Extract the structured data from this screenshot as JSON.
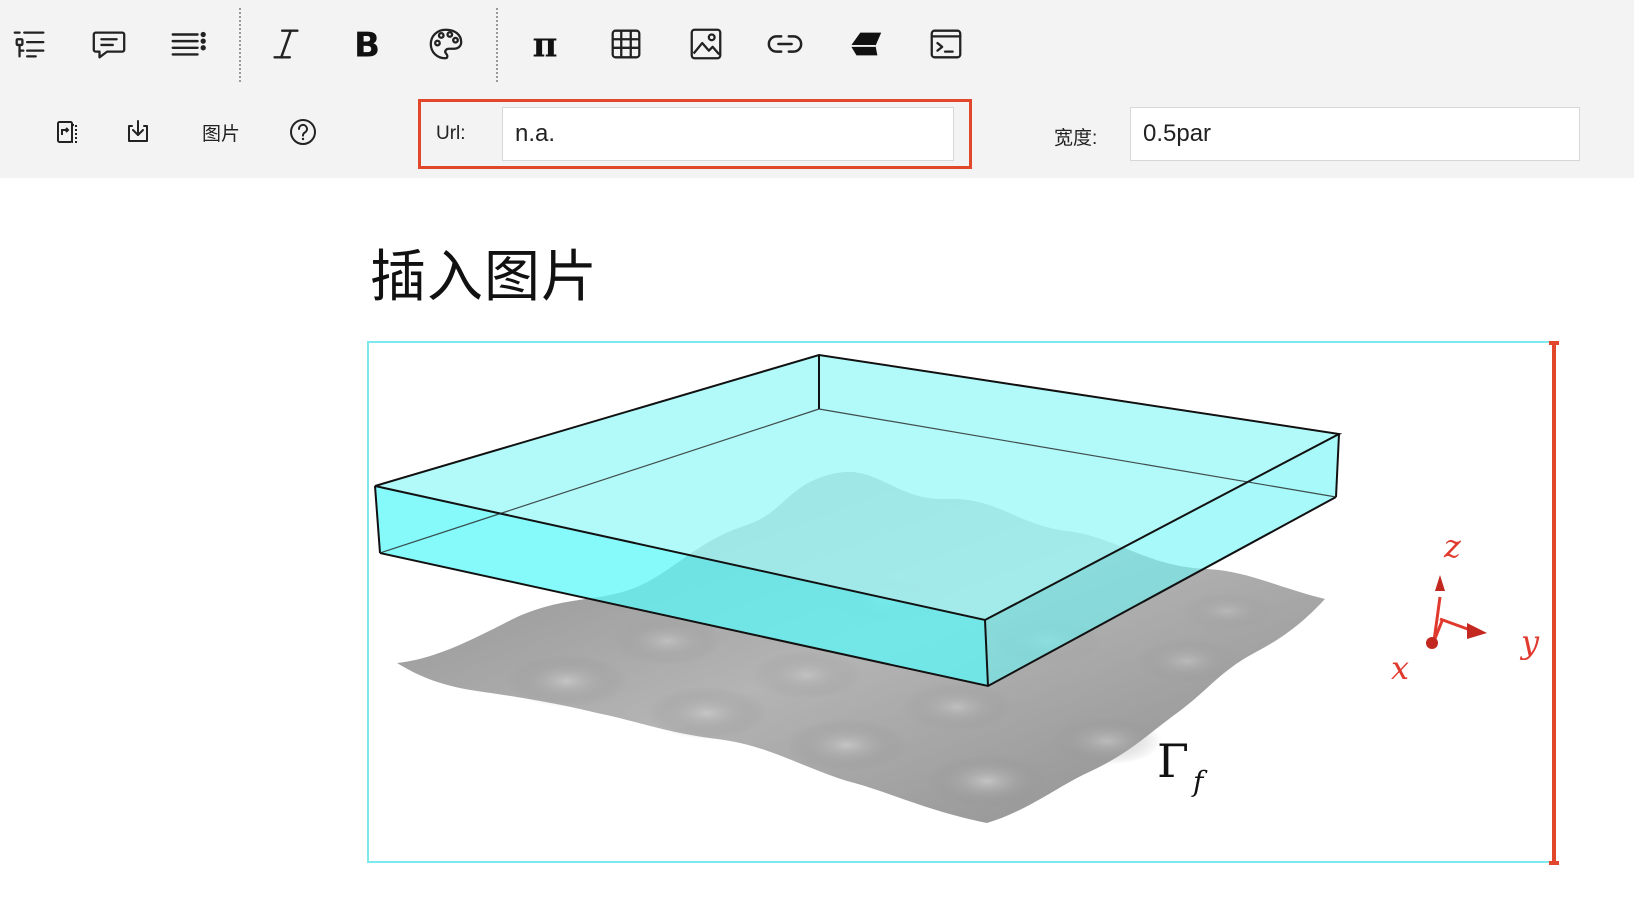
{
  "toolbar": {
    "row1": [
      {
        "name": "outline",
        "icon": "outline-list-icon"
      },
      {
        "name": "comment",
        "icon": "comment-icon"
      },
      {
        "name": "paragraph-list",
        "icon": "list-menu-icon"
      },
      {
        "name": "italic",
        "icon": "italic-icon"
      },
      {
        "name": "bold",
        "icon": "bold-icon"
      },
      {
        "name": "color",
        "icon": "palette-icon"
      },
      {
        "name": "math",
        "icon": "pi-icon"
      },
      {
        "name": "table",
        "icon": "table-icon"
      },
      {
        "name": "image",
        "icon": "image-icon"
      },
      {
        "name": "link",
        "icon": "link-icon"
      },
      {
        "name": "eraser",
        "icon": "eraser-icon"
      },
      {
        "name": "code",
        "icon": "terminal-icon"
      }
    ],
    "row2": {
      "replace_icon": "replace-file-icon",
      "download_icon": "download-icon",
      "image_label": "图片",
      "help_icon": "help-circle-icon"
    },
    "url_field": {
      "label": "Url:",
      "value": "n.a."
    },
    "width_field": {
      "label": "宽度:",
      "value": "0.5par"
    }
  },
  "document": {
    "title": "插入图片"
  },
  "figure": {
    "label": "Γ",
    "label_sub": "f",
    "axes": {
      "x": "x",
      "y": "y",
      "z": "z"
    },
    "colors": {
      "slab": "#7cf6f7",
      "surface": "#9a9a9a",
      "axes": "#e03a2f",
      "frame": "#7ee9ec"
    }
  },
  "colors": {
    "accent": "#e0472b",
    "toolbar_bg": "#f3f3f3"
  }
}
